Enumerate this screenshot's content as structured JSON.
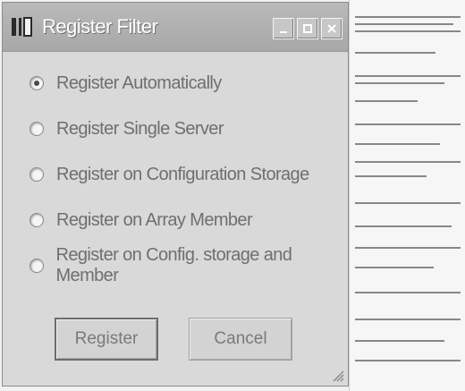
{
  "window": {
    "title": "Register Filter",
    "buttons": [
      "minimize",
      "maximize",
      "close"
    ]
  },
  "options": [
    {
      "label": "Register Automatically",
      "selected": true
    },
    {
      "label": "Register Single Server",
      "selected": false
    },
    {
      "label": "Register on Configuration Storage",
      "selected": false
    },
    {
      "label": "Register on Array Member",
      "selected": false
    },
    {
      "label": "Register on Config. storage and Member",
      "selected": false
    }
  ],
  "actions": {
    "register_label": "Register",
    "cancel_label": "Cancel"
  },
  "icons": {
    "app": "filter-app-icon",
    "minimize": "minimize-icon",
    "maximize": "maximize-icon",
    "close": "close-icon",
    "grip": "resize-grip-icon"
  },
  "colors": {
    "titlebar": "#b0b0b0",
    "dialog": "#d9d9d9"
  }
}
